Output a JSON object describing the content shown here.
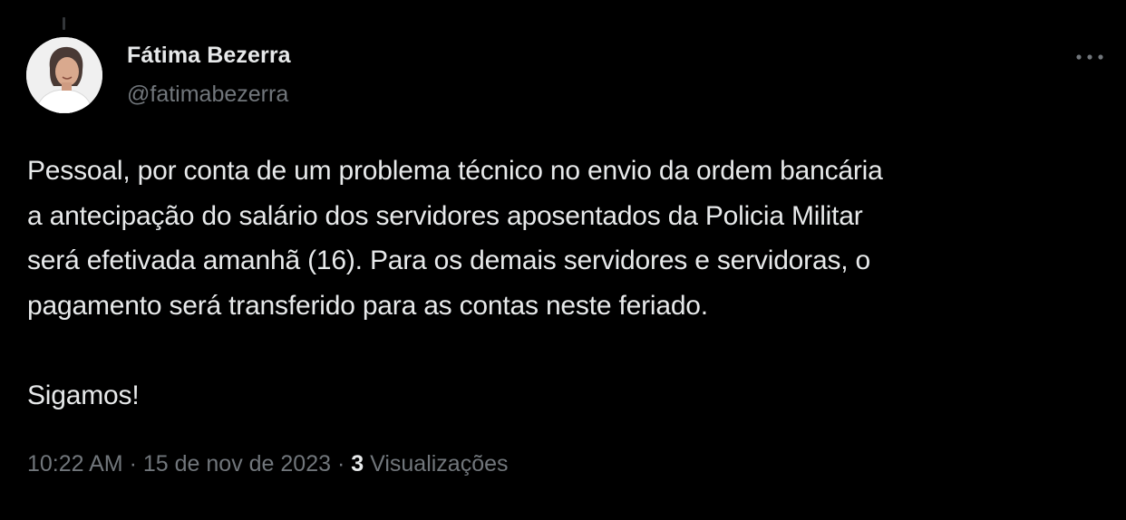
{
  "tweet": {
    "author": {
      "display_name": "Fátima Bezerra",
      "handle": "@fatimabezerra"
    },
    "text_lines": [
      "Pessoal, por conta de um problema técnico no envio da ordem bancária",
      "a antecipação do salário dos servidores aposentados da Policia Militar",
      "será efetivada amanhã (16). Para os demais servidores e servidoras, o",
      "pagamento será transferido para as contas neste feriado."
    ],
    "closing_line": "Sigamos!",
    "time": "10:22 AM",
    "separator": "·",
    "date": "15 de nov de 2023",
    "views_count": "3",
    "views_label": "Visualizações"
  },
  "colors": {
    "background": "#000000",
    "primary_text": "#e7e9ea",
    "secondary_text": "#71767b"
  },
  "icons": {
    "more": "more-horizontal-icon"
  }
}
